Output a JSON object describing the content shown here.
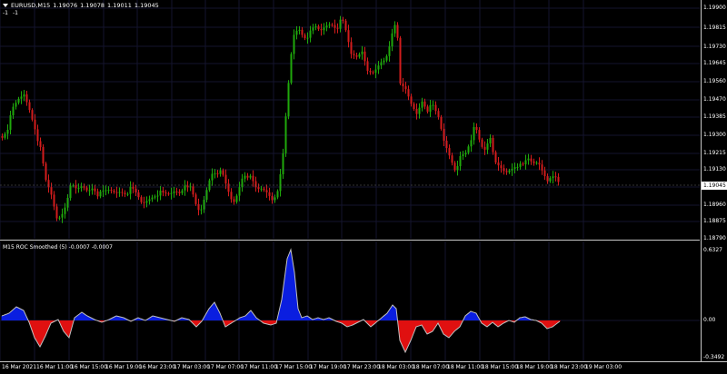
{
  "symbol": {
    "name": "EURUSD,M15",
    "open": "1.19076",
    "high": "1.19078",
    "low": "1.19011",
    "close": "1.19045"
  },
  "sub_labels": [
    "-1",
    "-1"
  ],
  "indicator": {
    "title": "M15 ROC Smoothed (5) -0.0007 -0.0007"
  },
  "price_axis": [
    "1.19900",
    "1.19815",
    "1.19730",
    "1.19645",
    "1.19560",
    "1.19470",
    "1.19385",
    "1.19300",
    "1.19215",
    "1.19130",
    "1.18960",
    "1.18875",
    "1.18790"
  ],
  "current_price": "1.19045",
  "indicator_axis": [
    "0.6327",
    "0.00",
    "-0.3492"
  ],
  "time_axis": [
    "16 Mar 2021",
    "16 Mar 11:00",
    "16 Mar 15:00",
    "16 Mar 19:00",
    "16 Mar 23:00",
    "17 Mar 03:00",
    "17 Mar 07:00",
    "17 Mar 11:00",
    "17 Mar 15:00",
    "17 Mar 19:00",
    "17 Mar 23:00",
    "18 Mar 03:00",
    "18 Mar 07:00",
    "18 Mar 11:00",
    "18 Mar 15:00",
    "18 Mar 19:00",
    "18 Mar 23:00",
    "19 Mar 03:00"
  ],
  "colors": {
    "background": "#000000",
    "grid": "#14142e",
    "bull": "#1fa80b",
    "bear": "#d21c1c",
    "ind_pos": "#0a1ee0",
    "ind_neg": "#e01010",
    "ind_line": "#c0c0c0"
  }
}
